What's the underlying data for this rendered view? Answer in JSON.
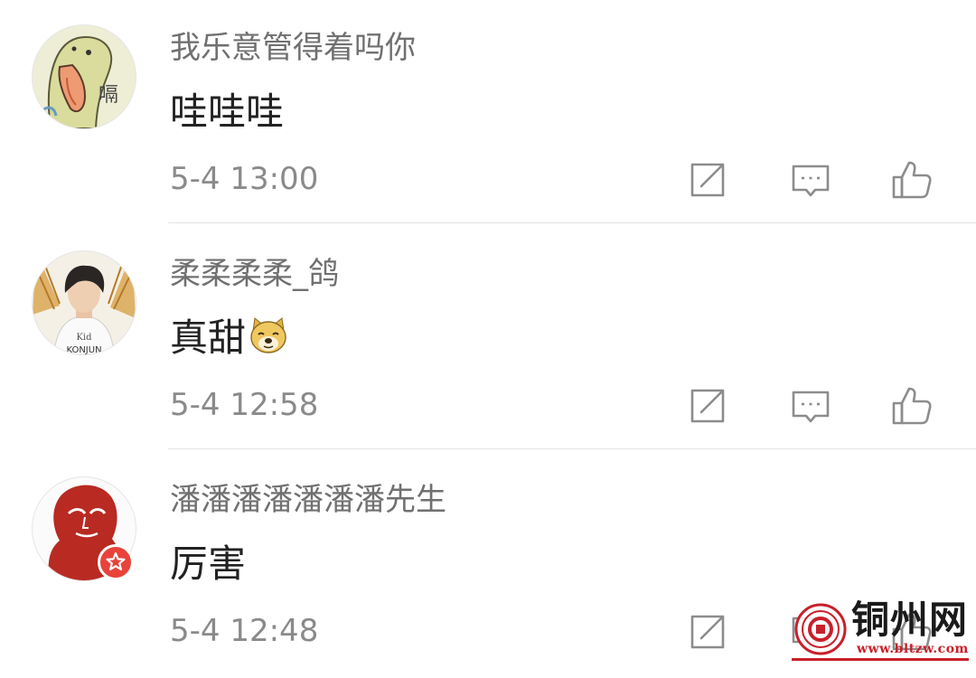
{
  "comments": [
    {
      "username": "我乐意管得着吗你",
      "text": "哇哇哇",
      "time": "5-4 13:00",
      "avatar": "cartoon-bird-avatar",
      "avatar_text": "嗝"
    },
    {
      "username": "柔柔柔柔_鸽",
      "text": "真甜",
      "emoji": "doge-emoji",
      "time": "5-4 12:58",
      "avatar": "young-man-photo-avatar"
    },
    {
      "username": "潘潘潘潘潘潘潘先生",
      "text": "厉害",
      "time": "5-4 12:48",
      "avatar": "red-portrait-avatar",
      "verified": true
    }
  ],
  "actions": [
    "repost-icon",
    "comment-icon",
    "like-icon"
  ],
  "colors": {
    "username": "#707070",
    "text": "#222222",
    "time": "#8a8a8a",
    "icon": "#8c8c8c",
    "divider": "#e3e3e3",
    "badge": "#e8433a",
    "watermark_red": "#c8202a"
  },
  "watermark": {
    "title": "铜州网",
    "url": "www.bltzw.com"
  }
}
